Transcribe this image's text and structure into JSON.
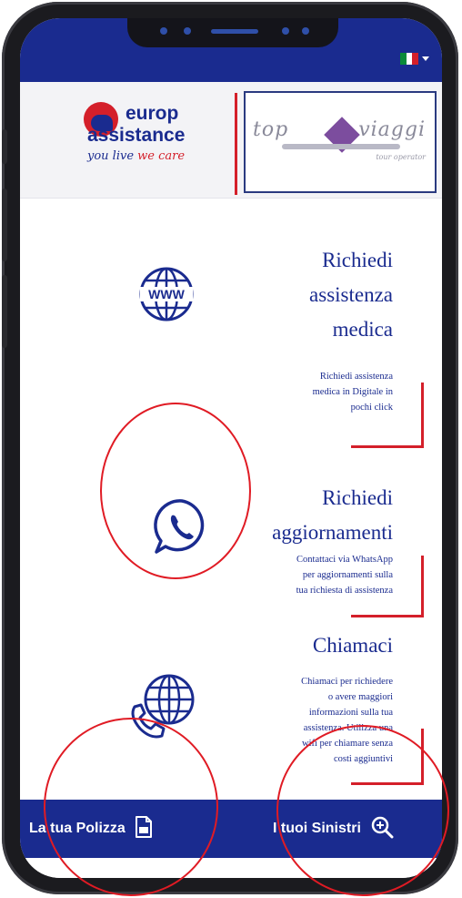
{
  "status_bar": {
    "language_flag": "italian-flag",
    "language_caret": "chevron-down-icon"
  },
  "header": {
    "brand_word1": "europ",
    "brand_word2": "assistance",
    "tagline_part1": "you live ",
    "tagline_part2": "we care",
    "partner_word1": "top",
    "partner_word2": "viaggi",
    "partner_sub": "tour operator"
  },
  "items": [
    {
      "icon": "www-globe-icon",
      "title_lines": [
        "Richiedi",
        "assistenza",
        "medica"
      ],
      "description_lines": [
        "Richiedi  assistenza",
        "medica in Digitale in",
        "pochi click"
      ]
    },
    {
      "icon": "whatsapp-icon",
      "title_lines": [
        "Richiedi",
        "aggiornamenti"
      ],
      "description_lines": [
        "Contattaci via WhatsApp",
        "per aggiornamenti sulla",
        "tua richiesta di assistenza"
      ]
    },
    {
      "icon": "globe-phone-icon",
      "title_lines": [
        "Chiamaci"
      ],
      "description_lines": [
        "Chiamaci per richiedere",
        "o avere maggiori",
        "informazioni sulla tua",
        "assistenza. Utilizza una",
        "wifi per chiamare senza",
        "costi aggiuntivi"
      ]
    }
  ],
  "bottom_bar": {
    "policy_label": "La tua Polizza",
    "policy_icon": "document-icon",
    "claims_label": "I tuoi Sinistri",
    "claims_icon": "search-plus-icon"
  },
  "colors": {
    "brand_blue": "#1a2b8f",
    "accent_red": "#d41f2a",
    "annotation_red": "#e01b24"
  }
}
